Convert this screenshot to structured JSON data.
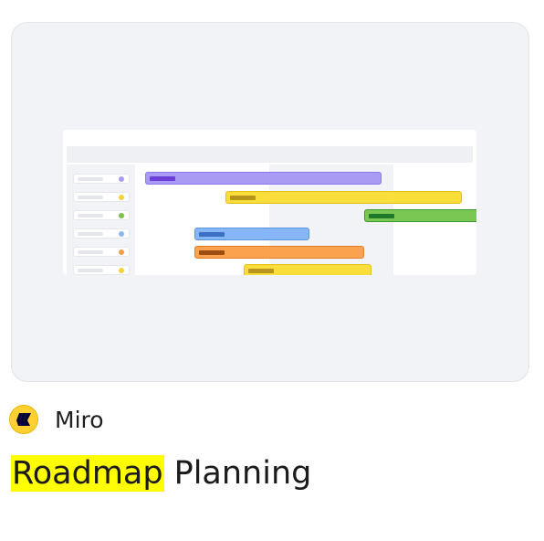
{
  "result": {
    "source": {
      "name": "Miro",
      "logo_icon": "miro-logo-icon",
      "logo_color": "#ffd02f"
    },
    "title": {
      "highlighted": "Roadmap",
      "rest": "Planning",
      "highlight_color": "#ffff00"
    },
    "preview": {
      "description_icon": "gantt-roadmap-thumbnail",
      "row_dot_colors": [
        "#a89cf0",
        "#f5d437",
        "#7dc24d",
        "#8db6f5",
        "#f39c4d",
        "#f5d437"
      ],
      "bars": [
        {
          "color": "#a99bf4",
          "dark": "#6a3fd8"
        },
        {
          "color": "#fcde3a",
          "dark": "#b8941a"
        },
        {
          "color": "#7ac853",
          "dark": "#1e7a2a"
        },
        {
          "color": "#86b6f5",
          "dark": "#3d6fc4"
        },
        {
          "color": "#fba24f",
          "dark": "#9c4e10"
        },
        {
          "color": "#fcde3a",
          "dark": "#b8941a"
        }
      ]
    }
  }
}
